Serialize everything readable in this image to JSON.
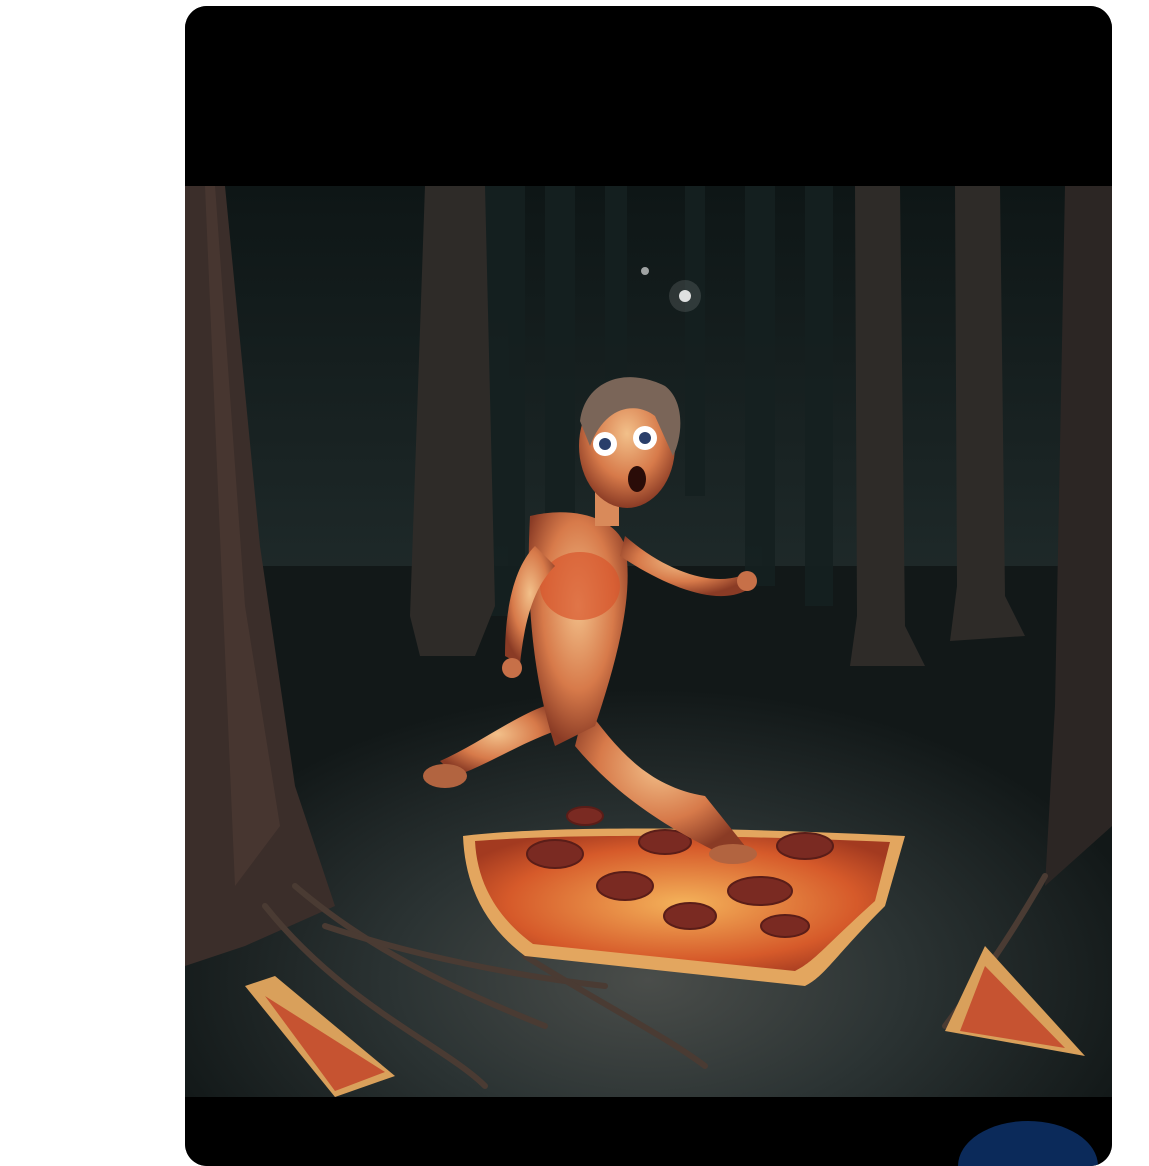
{
  "post": {
    "media": {
      "alt": "",
      "icon": "image"
    }
  },
  "colors": {
    "card_background": "#000000",
    "page_background": "#ffffff",
    "fab_color": "#0b2a5a",
    "forest_dark": "#1c2526",
    "pizza_crust": "#d9a05b",
    "pizza_sauce": "#c2452a",
    "pepperoni": "#7a2a22"
  },
  "bottom_bar": {
    "fab_icon": "action-circle-icon"
  }
}
